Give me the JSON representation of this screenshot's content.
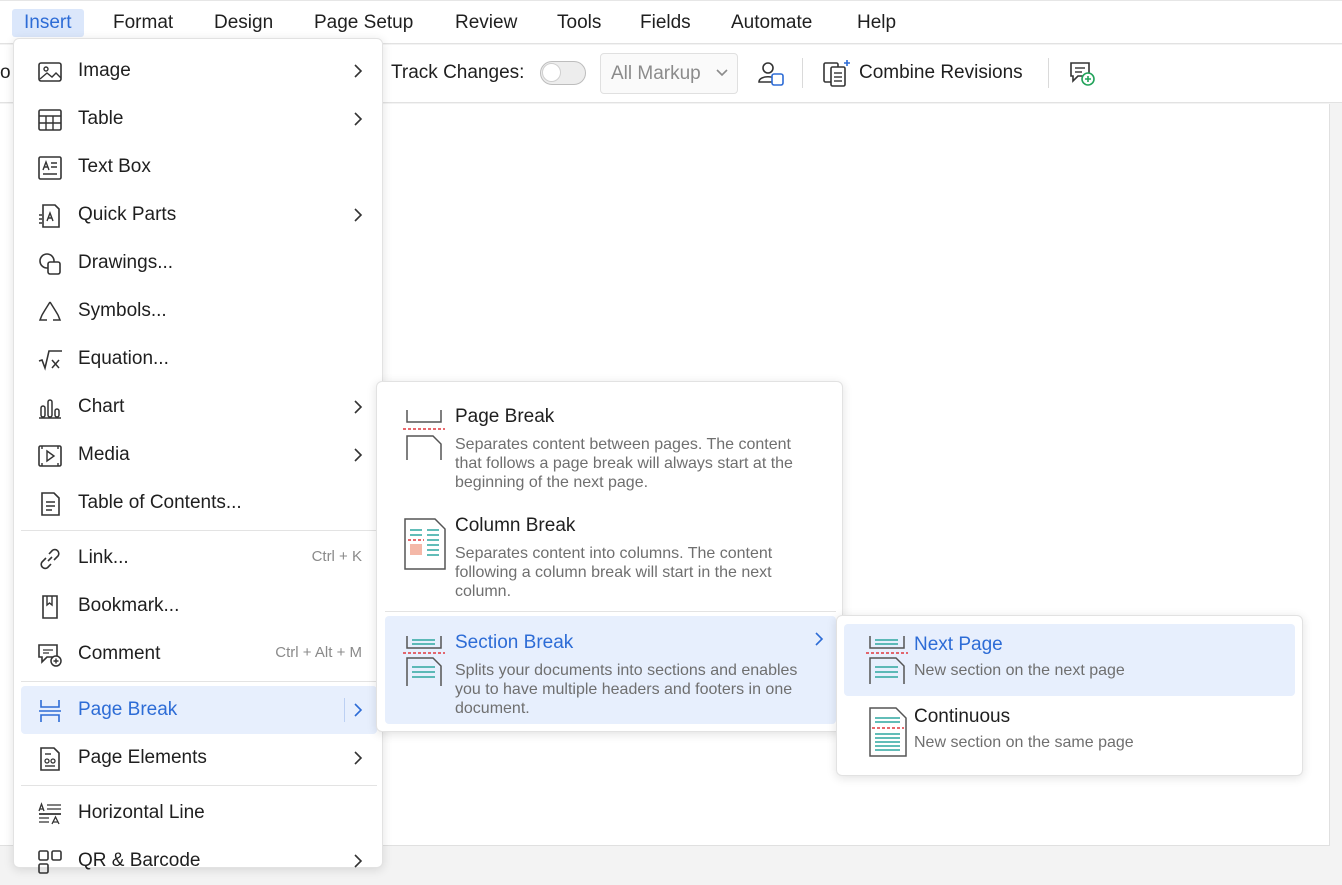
{
  "menubar": {
    "items": [
      "Insert",
      "Format",
      "Design",
      "Page Setup",
      "Review",
      "Tools",
      "Fields",
      "Automate",
      "Help"
    ],
    "active": "Insert"
  },
  "toolbar": {
    "partial_label": "o",
    "track_changes_label": "Track Changes:",
    "track_changes_on": false,
    "markup_select_value": "All Markup",
    "combine_revisions_label": "Combine Revisions"
  },
  "insert_menu": {
    "items": [
      {
        "label": "Image",
        "icon": "image-icon",
        "submenu": true
      },
      {
        "label": "Table",
        "icon": "table-icon",
        "submenu": true
      },
      {
        "label": "Text Box",
        "icon": "text-box-icon",
        "submenu": false
      },
      {
        "label": "Quick Parts",
        "icon": "quick-parts-icon",
        "submenu": true
      },
      {
        "label": "Drawings...",
        "icon": "drawings-icon",
        "submenu": false
      },
      {
        "label": "Symbols...",
        "icon": "symbols-icon",
        "submenu": false
      },
      {
        "label": "Equation...",
        "icon": "equation-icon",
        "submenu": false
      },
      {
        "label": "Chart",
        "icon": "chart-icon",
        "submenu": true
      },
      {
        "label": "Media",
        "icon": "media-icon",
        "submenu": true
      },
      {
        "label": "Table of Contents...",
        "icon": "table-of-contents-icon",
        "submenu": false
      },
      {
        "label": "Link...",
        "icon": "link-icon",
        "shortcut": "Ctrl + K"
      },
      {
        "label": "Bookmark...",
        "icon": "bookmark-icon"
      },
      {
        "label": "Comment",
        "icon": "comment-icon",
        "shortcut": "Ctrl + Alt + M"
      },
      {
        "label": "Page Break",
        "icon": "page-break-icon",
        "submenu": true,
        "highlighted": true
      },
      {
        "label": "Page Elements",
        "icon": "page-elements-icon",
        "submenu": true
      },
      {
        "label": "Horizontal Line",
        "icon": "horizontal-line-icon"
      },
      {
        "label": "QR & Barcode",
        "icon": "qr-barcode-icon",
        "submenu": true
      }
    ]
  },
  "page_break_menu": {
    "items": [
      {
        "title": "Page Break",
        "description": "Separates content between pages. The content that follows a page break will always start at the beginning of the next page."
      },
      {
        "title": "Column Break",
        "description": "Separates content into columns. The content following a column break will start in the next column."
      },
      {
        "title": "Section Break",
        "description": "Splits your documents into sections and enables you to have multiple headers and footers in one document.",
        "highlighted": true
      }
    ]
  },
  "section_break_menu": {
    "items": [
      {
        "title": "Next Page",
        "description": "New section on the next page",
        "highlighted": true
      },
      {
        "title": "Continuous",
        "description": "New section on the same page"
      }
    ]
  },
  "colors": {
    "accent": "#2d6cd6",
    "highlight": "#e7effd",
    "break_line": "#e0393e",
    "doc_lines": "#2ea7a0"
  }
}
